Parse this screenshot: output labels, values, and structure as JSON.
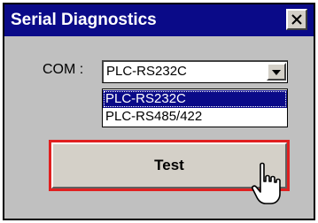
{
  "window": {
    "title": "Serial Diagnostics",
    "close_label": "×"
  },
  "com": {
    "label": "COM :",
    "selected_value": "PLC-RS232C",
    "options": [
      "PLC-RS232C",
      "PLC-RS485/422"
    ],
    "highlighted_index": 0
  },
  "test_button": {
    "label": "Test"
  },
  "icons": {
    "close": "close-icon",
    "dropdown": "chevron-down-icon",
    "cursor": "hand-pointer-icon"
  },
  "colors": {
    "titlebar": "#0a0a88",
    "highlight": "#0a0a88",
    "button_focus_border": "#e02020",
    "dialog_bg": "#c0c0c0"
  }
}
